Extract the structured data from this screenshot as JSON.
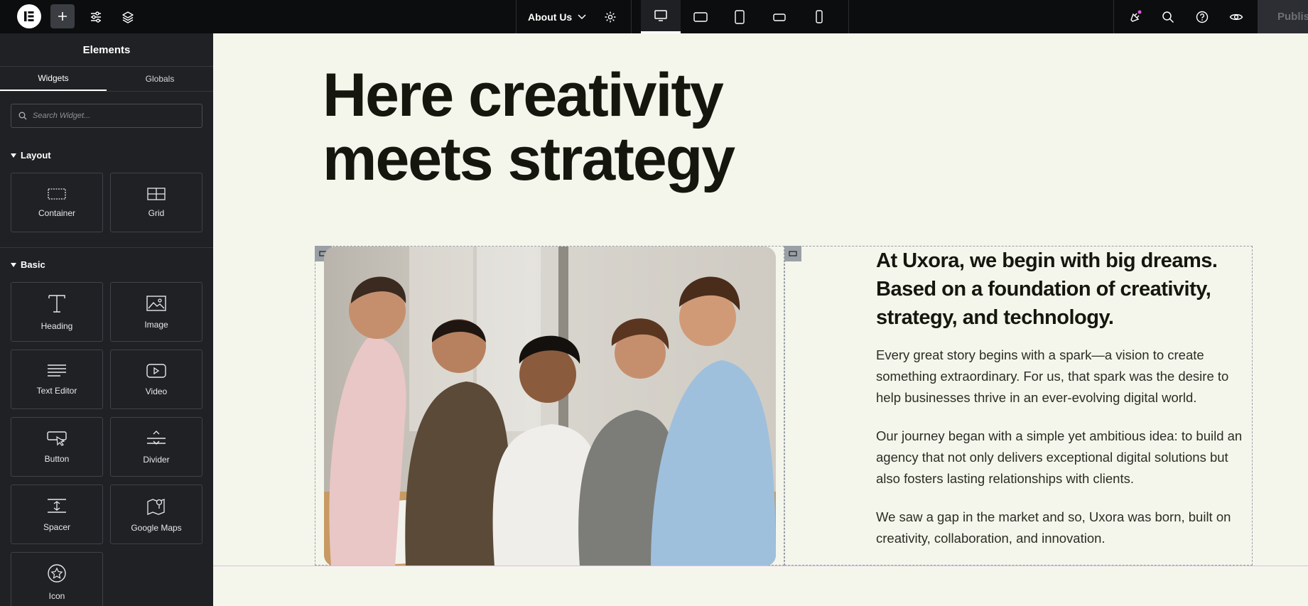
{
  "topbar": {
    "page_name": "About Us",
    "publish_label": "Publish",
    "devices": [
      "desktop",
      "tablet-landscape",
      "tablet",
      "mobile-landscape",
      "mobile"
    ],
    "active_device": "desktop",
    "icons": [
      "elementor-logo-icon",
      "plus-icon",
      "settings-sliders-icon",
      "layers-icon",
      "page-settings-icon",
      "notifications-icon",
      "search-icon",
      "help-icon",
      "preview-eye-icon"
    ]
  },
  "sidebar": {
    "title": "Elements",
    "tabs": [
      "Widgets",
      "Globals"
    ],
    "active_tab": "Widgets",
    "search_placeholder": "Search Widget...",
    "categories": [
      {
        "label": "Layout",
        "widgets": [
          "Container",
          "Grid"
        ]
      },
      {
        "label": "Basic",
        "widgets": [
          "Heading",
          "Image",
          "Text Editor",
          "Video",
          "Button",
          "Divider",
          "Spacer",
          "Google Maps",
          "Icon"
        ]
      }
    ]
  },
  "canvas": {
    "hero_line1": "Here creativity",
    "hero_line2": "meets strategy",
    "sub_heading": "At Uxora, we begin with big dreams. Based on a foundation of creativity, strategy, and technology.",
    "paragraphs": [
      "Every great story begins with a spark—a vision to create something extraordinary. For us, that spark was the desire to help businesses thrive in an ever-evolving digital world.",
      "Our journey began with a simple yet ambitious idea: to build an agency that not only delivers exceptional digital solutions but also fosters lasting relationships with clients.",
      "We saw a gap in the market and so, Uxora was born, built on creativity, collaboration, and innovation."
    ]
  },
  "colors": {
    "topbar_bg": "#0c0d0e",
    "sidebar_bg": "#1f2124",
    "canvas_bg": "#f4f6ec",
    "heading_text": "#15170e"
  }
}
